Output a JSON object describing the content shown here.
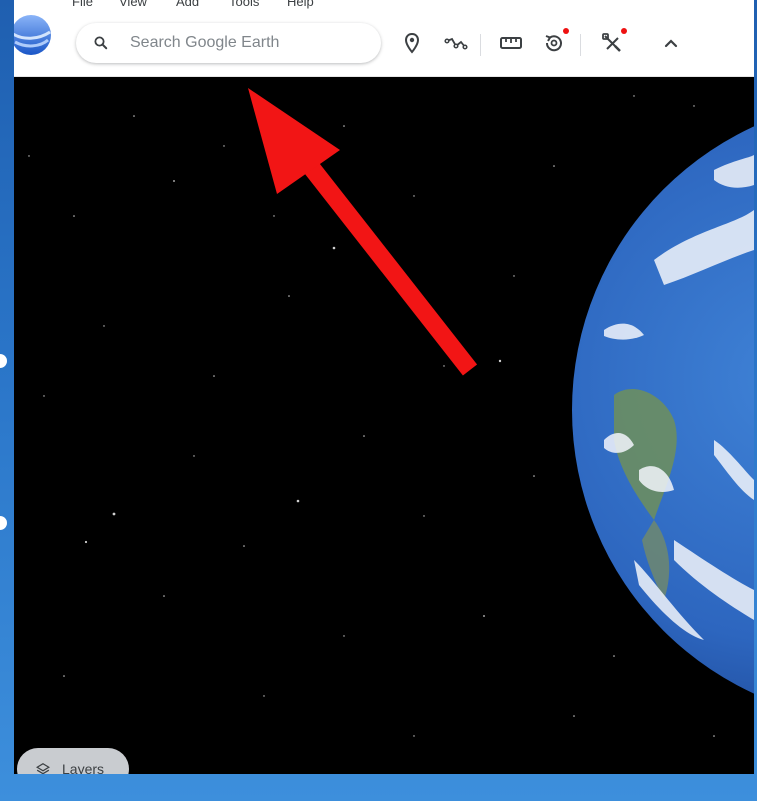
{
  "menu": {
    "items": [
      "File",
      "View",
      "Add",
      "Tools",
      "Help"
    ]
  },
  "search": {
    "placeholder": "Search Google Earth"
  },
  "toolbar": {
    "icons": [
      "place-pin-icon",
      "path-icon",
      "ruler-icon",
      "history-icon",
      "voyager-icon",
      "collapse-icon"
    ]
  },
  "layers": {
    "label": "Layers"
  },
  "colors": {
    "annotation_arrow": "#f21515",
    "space": "#000000",
    "ocean": "#2f6fc6",
    "toolbar_bg": "#ffffff",
    "notification_dot": "#e11111"
  }
}
